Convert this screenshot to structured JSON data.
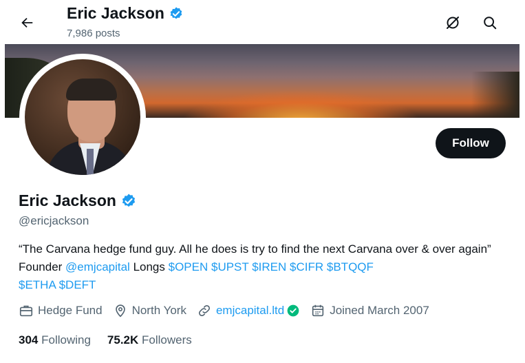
{
  "header": {
    "name": "Eric Jackson",
    "posts": "7,986 posts"
  },
  "profile": {
    "name": "Eric Jackson",
    "handle": "@ericjackson",
    "follow_label": "Follow",
    "bio": {
      "text_1": "“The Carvana hedge fund guy. All he does is try to find the next Carvana over & over again” Founder ",
      "mention": "@emjcapital",
      "text_2": " Longs ",
      "tickers": [
        "$OPEN",
        "$UPST",
        "$IREN",
        "$CIFR",
        "$BTQQF",
        "$ETHA",
        "$DEFT"
      ]
    },
    "meta": {
      "category": "Hedge Fund",
      "location": "North York",
      "website": "emjcapital.ltd",
      "joined": "Joined March 2007"
    },
    "stats": {
      "following_count": "304",
      "following_label": "Following",
      "followers_count": "75.2K",
      "followers_label": "Followers"
    }
  },
  "icons": {
    "back": "arrow-left-icon",
    "grok": "grok-icon",
    "search": "search-icon",
    "verified": "verified-badge-icon",
    "briefcase": "briefcase-icon",
    "location": "location-pin-icon",
    "link": "link-icon",
    "calendar": "calendar-icon"
  },
  "colors": {
    "accent": "#1d9bf0",
    "text": "#0f1419",
    "secondary": "#536471",
    "verified_link": "#00ba7c"
  }
}
